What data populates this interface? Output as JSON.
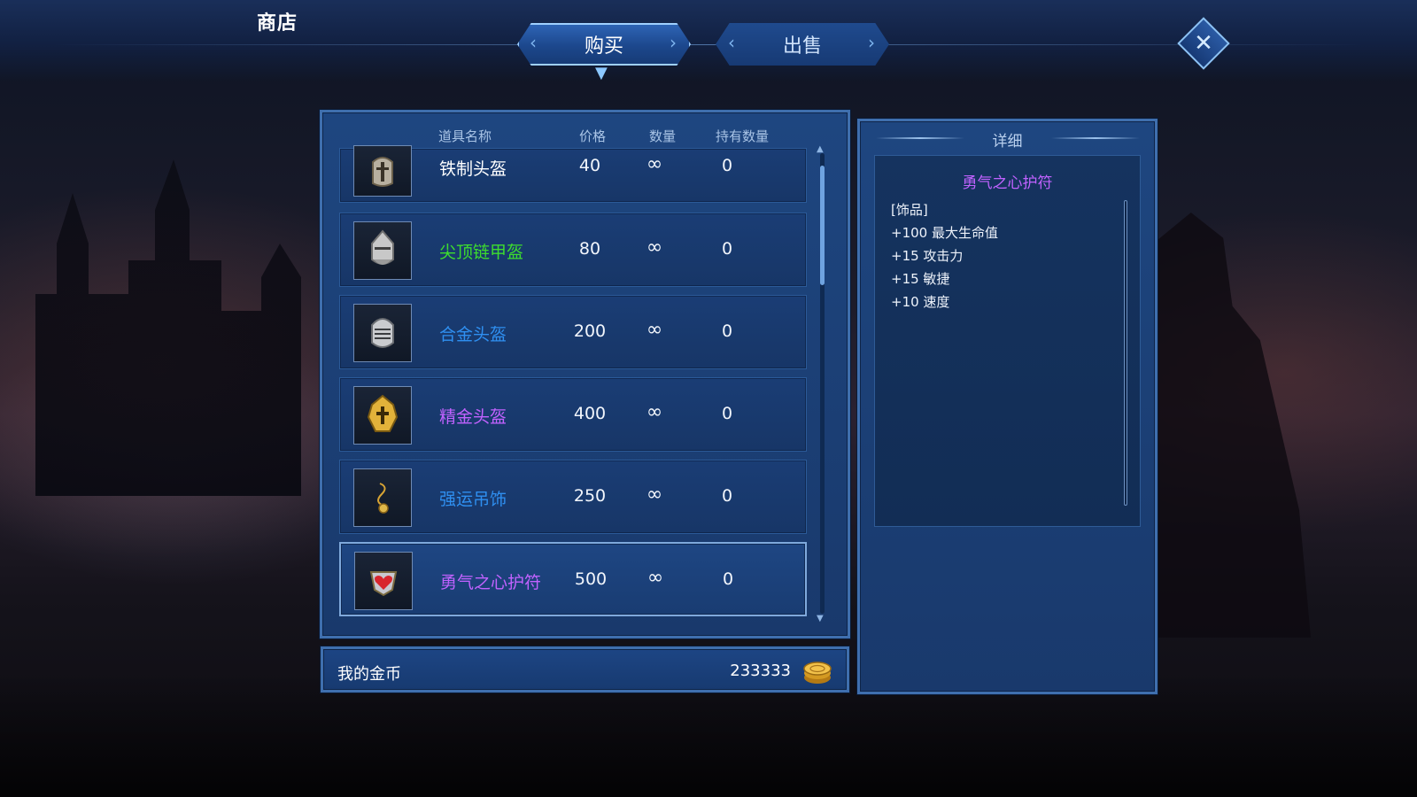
{
  "header": {
    "title": "商店",
    "tabs": [
      {
        "label": "购买",
        "active": true
      },
      {
        "label": "出售",
        "active": false
      }
    ],
    "close_icon": "close-icon"
  },
  "item_list": {
    "columns": [
      "道具名称",
      "价格",
      "数量",
      "持有数量"
    ],
    "items": [
      {
        "name": "铁制头盔",
        "price": "40",
        "quantity": "∞",
        "held": "0",
        "name_color": "#ffffff",
        "icon": "iron-helmet-icon"
      },
      {
        "name": "尖顶链甲盔",
        "price": "80",
        "quantity": "∞",
        "held": "0",
        "name_color": "#3ddc2e",
        "icon": "pointed-chain-helmet-icon"
      },
      {
        "name": "合金头盔",
        "price": "200",
        "quantity": "∞",
        "held": "0",
        "name_color": "#2f8ff0",
        "icon": "alloy-helmet-icon"
      },
      {
        "name": "精金头盔",
        "price": "400",
        "quantity": "∞",
        "held": "0",
        "name_color": "#c162ff",
        "icon": "gold-helmet-icon"
      },
      {
        "name": "强运吊饰",
        "price": "250",
        "quantity": "∞",
        "held": "0",
        "name_color": "#2f8ff0",
        "icon": "luck-pendant-icon"
      },
      {
        "name": "勇气之心护符",
        "price": "500",
        "quantity": "∞",
        "held": "0",
        "name_color": "#c162ff",
        "icon": "heart-amulet-icon",
        "selected": true
      }
    ]
  },
  "detail": {
    "header": "详细",
    "item_name": "勇气之心护符",
    "item_name_color": "#c162ff",
    "lines": [
      "[饰品]",
      "+100 最大生命值",
      "+15 攻击力",
      "+15 敏捷",
      "+10 速度"
    ]
  },
  "gold": {
    "label": "我的金币",
    "amount": "233333",
    "icon": "gold-coin-icon"
  },
  "colors": {
    "panel_blue": "#1e4680",
    "border_blue": "#3f6fae",
    "epic_purple": "#c162ff",
    "rare_blue": "#2f8ff0",
    "uncommon_green": "#3ddc2e"
  }
}
